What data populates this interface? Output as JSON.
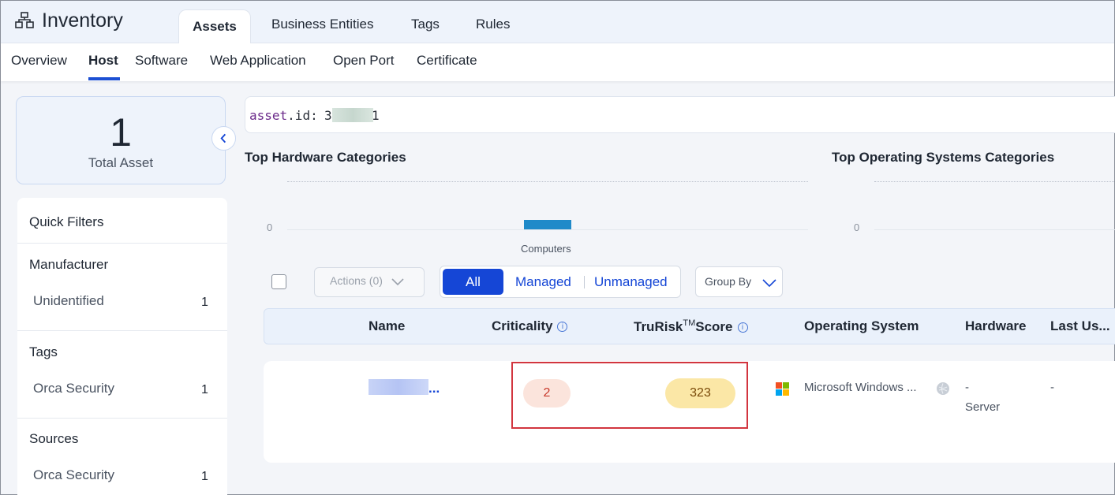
{
  "app": {
    "title": "Inventory"
  },
  "main_tabs": [
    {
      "label": "Assets",
      "active": true
    },
    {
      "label": "Business Entities",
      "active": false
    },
    {
      "label": "Tags",
      "active": false
    },
    {
      "label": "Rules",
      "active": false
    }
  ],
  "sub_tabs": [
    {
      "label": "Overview",
      "active": false
    },
    {
      "label": "Host",
      "active": true
    },
    {
      "label": "Software",
      "active": false
    },
    {
      "label": "Web Application",
      "active": false
    },
    {
      "label": "Open Port",
      "active": false
    },
    {
      "label": "Certificate",
      "active": false
    }
  ],
  "summary": {
    "total_count": "1",
    "total_label": "Total Asset"
  },
  "filters": {
    "title": "Quick Filters",
    "groups": [
      {
        "heading": "Manufacturer",
        "item": "Unidentified",
        "count": "1"
      },
      {
        "heading": "Tags",
        "item": "Orca Security",
        "count": "1"
      },
      {
        "heading": "Sources",
        "item": "Orca Security",
        "count": "1"
      }
    ]
  },
  "search": {
    "field": "asset",
    "prop": ".id:",
    "value_start": "3",
    "value_end": "1"
  },
  "charts": {
    "hardware_title": "Top Hardware Categories",
    "os_title": "Top Operating Systems Categories",
    "zero_label": "0",
    "bar_label": "Computers"
  },
  "chart_data": [
    {
      "type": "bar",
      "title": "Top Hardware Categories",
      "categories": [
        "Computers"
      ],
      "values": [
        1
      ]
    },
    {
      "type": "bar",
      "title": "Top Operating Systems Categories",
      "categories": [],
      "values": []
    }
  ],
  "toolbar": {
    "actions_label": "Actions (0)",
    "segments": [
      "All",
      "Managed",
      "Unmanaged"
    ],
    "group_by_label": "Group By"
  },
  "table": {
    "headers": {
      "name": "Name",
      "criticality": "Criticality",
      "trurisk": "TruRisk",
      "tm": "TM",
      "score": "Score",
      "os": "Operating System",
      "hardware": "Hardware",
      "last": "Last Us..."
    },
    "row": {
      "name_suffix": "...",
      "criticality": "2",
      "score": "323",
      "os": "Microsoft Windows ...",
      "hardware": "-",
      "hardware_type": "Server",
      "last_used": "-"
    }
  },
  "colors": {
    "accent": "#1546d6",
    "bar": "#1f8ac9",
    "criticality_bg": "#fbe4dc",
    "score_bg": "#fbe7a6",
    "highlight": "#d2353f"
  }
}
